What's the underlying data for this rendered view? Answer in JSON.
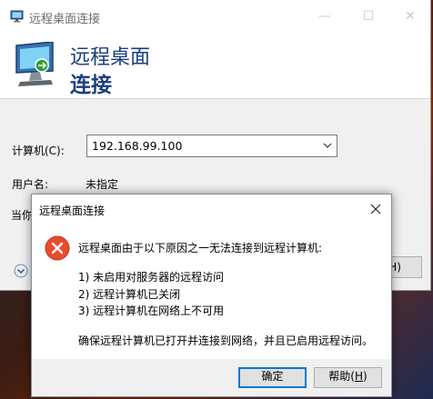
{
  "window": {
    "title": "远程桌面连接",
    "controls": {
      "minimize": "—",
      "maximize": "☐",
      "close": "✕"
    }
  },
  "banner": {
    "line1": "远程桌面",
    "line2": "连接"
  },
  "form": {
    "computer_label": "计算机(C):",
    "computer_value": "192.168.99.100",
    "username_label": "用户名:",
    "username_value": "未指定",
    "partial_label": "当你",
    "help_partial": "H)"
  },
  "dialog": {
    "title": "远程桌面连接",
    "message": "远程桌面由于以下原因之一无法连接到远程计算机:",
    "reasons": [
      "1) 未启用对服务器的远程访问",
      "2) 远程计算机已关闭",
      "3) 远程计算机在网络上不可用"
    ],
    "footer": "确保远程计算机已打开并连接到网络，并且已启用远程访问。",
    "ok_label": "确定",
    "help_label": "帮助(",
    "help_accel": "H",
    "help_suffix": ")"
  },
  "icons": {
    "app": "remote-desktop-icon",
    "computer": "computer-monitor-icon",
    "error": "error-x-icon",
    "options": "chevron-down-circle-icon",
    "combo": "chevron-down-icon",
    "close": "close-icon"
  },
  "colors": {
    "banner_text": "#1a3f7f",
    "error_red": "#e74c2f",
    "focus_blue": "#0078d7"
  }
}
